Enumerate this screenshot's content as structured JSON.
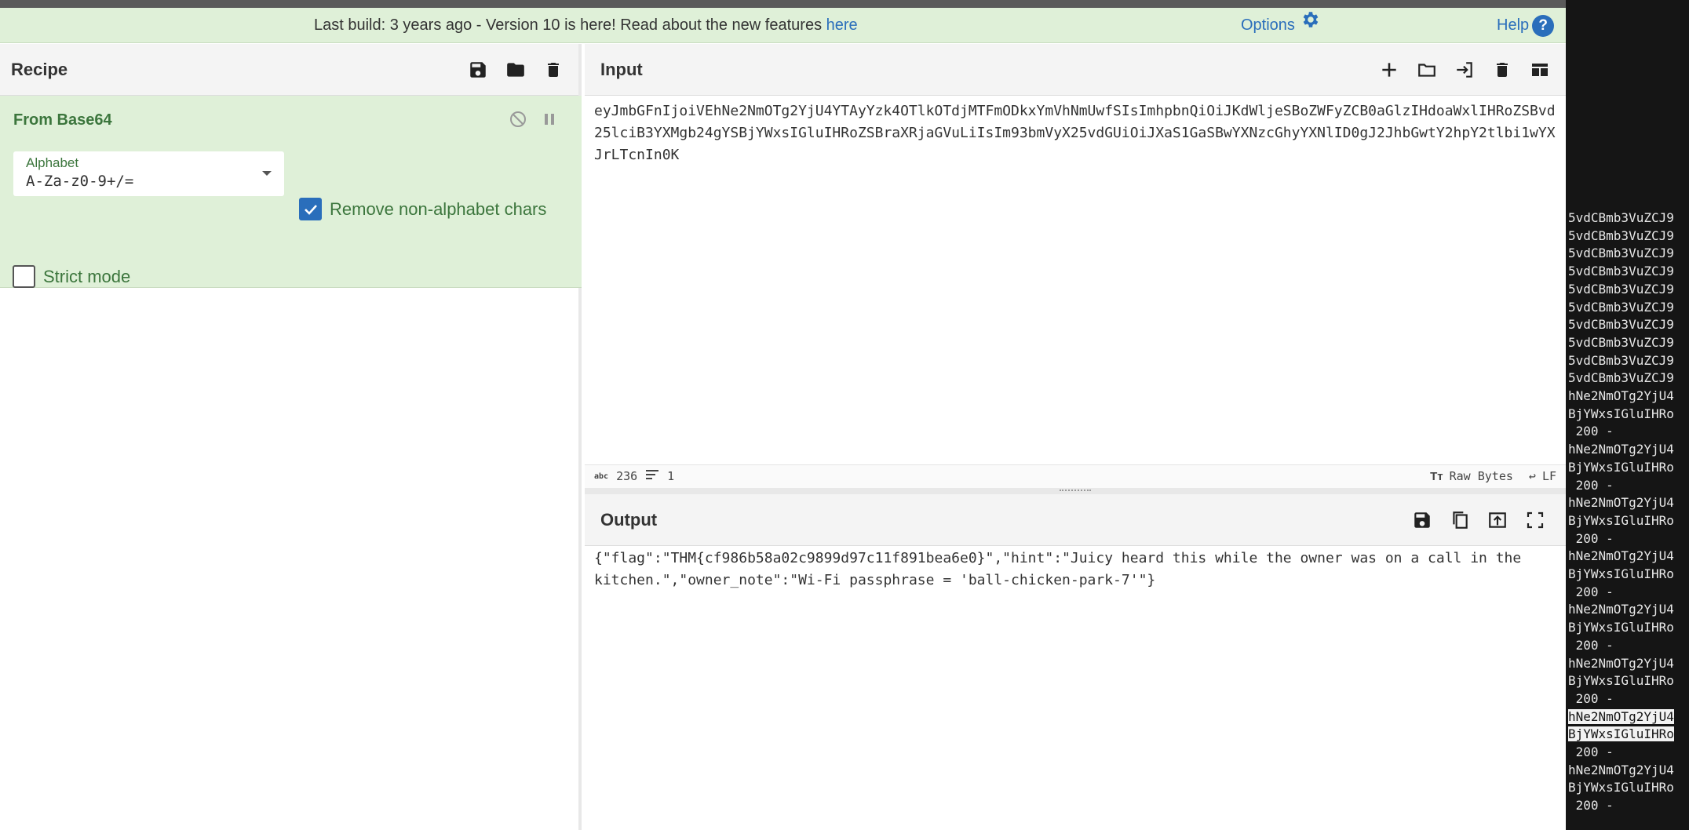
{
  "banner": {
    "message_prefix": "Last build: 3 years ago - Version 10 is here! Read about the new features ",
    "message_link": "here",
    "options_label": "Options",
    "help_label": "Help",
    "help_icon": "?"
  },
  "recipe": {
    "title": "Recipe",
    "operation": {
      "title": "From Base64",
      "alphabet_label": "Alphabet",
      "alphabet_value": "A-Za-z0-9+/=",
      "remove_non_alphabet_label": "Remove non-alphabet chars",
      "remove_non_alphabet_checked": true,
      "strict_mode_label": "Strict mode",
      "strict_mode_checked": false
    }
  },
  "input": {
    "title": "Input",
    "text": "eyJmbGFnIjoiVEhNe2NmOTg2YjU4YTAyYzk4OTlkOTdjMTFmODkxYmVhNmUwfSIsImhpbnQiOiJKdWljeSBoZWFyZCB0aGlzIHdoaWxlIHRoZSBvd25lciB3YXMgb24gYSBjYWxsIGluIHRoZSBraXRjaGVuLiIsIm93bmVyX25vdGUiOiJXaS1GaSBwYXNzcGhyYXNlID0gJ2JhbGwtY2hpY2tlbi1wYXJrLTcnIn0K",
    "char_count_icon": "abc",
    "char_count": "236",
    "line_count": "1",
    "raw_bytes_label": "Raw Bytes",
    "line_ending_label": "LF"
  },
  "output": {
    "title": "Output",
    "text": "{\"flag\":\"THM{cf986b58a02c9899d97c11f891bea6e0}\",\"hint\":\"Juicy heard this while the owner was on a call in the kitchen.\",\"owner_note\":\"Wi-Fi passphrase = 'ball-chicken-park-7'\"}"
  },
  "terminal": {
    "lines": [
      "5vdCBmb3VuZCJ9",
      "5vdCBmb3VuZCJ9",
      "5vdCBmb3VuZCJ9",
      "5vdCBmb3VuZCJ9",
      "5vdCBmb3VuZCJ9",
      "5vdCBmb3VuZCJ9",
      "5vdCBmb3VuZCJ9",
      "5vdCBmb3VuZCJ9",
      "5vdCBmb3VuZCJ9",
      "5vdCBmb3VuZCJ9",
      "hNe2NmOTg2YjU4",
      "BjYWxsIGluIHRo",
      " 200 -",
      "hNe2NmOTg2YjU4",
      "BjYWxsIGluIHRo",
      " 200 -",
      "hNe2NmOTg2YjU4",
      "BjYWxsIGluIHRo",
      " 200 -",
      "hNe2NmOTg2YjU4",
      "BjYWxsIGluIHRo",
      " 200 -",
      "hNe2NmOTg2YjU4",
      "BjYWxsIGluIHRo",
      " 200 -",
      "hNe2NmOTg2YjU4",
      "BjYWxsIGluIHRo",
      " 200 -",
      "hNe2NmOTg2YjU4",
      "BjYWxsIGluIHRo",
      " 200 -",
      "hNe2NmOTg2YjU4",
      "BjYWxsIGluIHRo",
      " 200 -"
    ],
    "selected_lines": [
      28,
      29
    ]
  },
  "icons": {
    "save": "save-icon",
    "folder": "folder-icon",
    "trash": "trash-icon",
    "plus": "plus-icon",
    "open_folder": "open-folder-icon",
    "import": "import-icon",
    "layout": "layout-icon",
    "copy": "copy-icon",
    "replace_input": "replace-input-icon",
    "fullscreen": "fullscreen-icon",
    "disable": "disable-icon",
    "pause": "pause-icon",
    "gear": "gear-icon"
  }
}
